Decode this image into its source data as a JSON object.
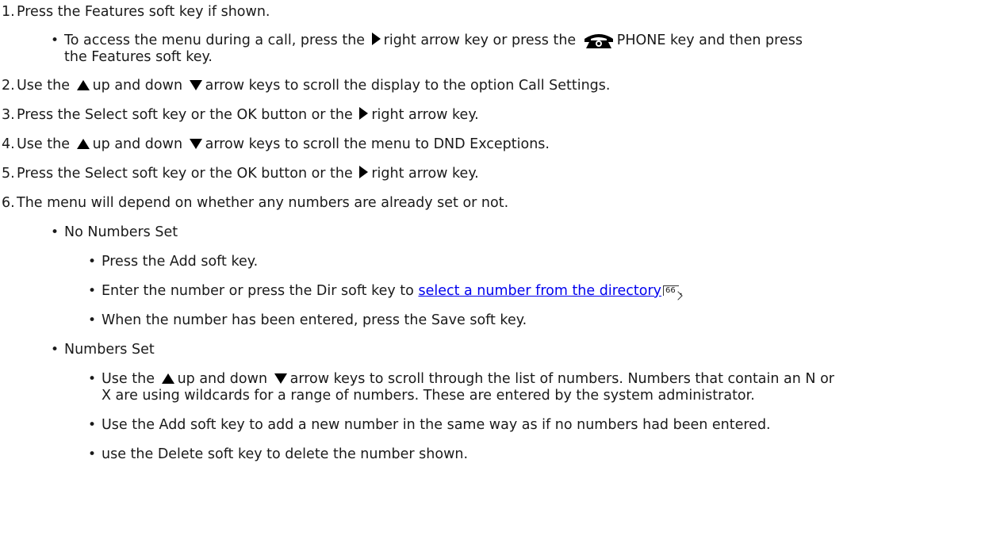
{
  "steps": [
    {
      "num": "1.",
      "text": "Press the Features soft key if shown."
    },
    {
      "num": "2.",
      "pre": "Use the",
      "mid": "up and down",
      "post": "arrow keys to scroll the display to the option Call Settings."
    },
    {
      "num": "3.",
      "pre": "Press the Select soft key or the OK button or the",
      "post": "right arrow key."
    },
    {
      "num": "4.",
      "pre": "Use the",
      "mid": "up and down",
      "post": "arrow keys to scroll the menu to DND Exceptions."
    },
    {
      "num": "5.",
      "pre": "Press the Select soft key or the OK button or the",
      "post": "right arrow key."
    },
    {
      "num": "6.",
      "text": "The menu will depend on whether any numbers are already set or not."
    }
  ],
  "sub1": {
    "pre": "To access the menu during a call, press the",
    "mid": "right arrow key or press the",
    "post": "PHONE key and then press",
    "line2": "the Features soft key."
  },
  "no_numbers": {
    "heading": "No Numbers Set",
    "add": "Press the Add soft key.",
    "dir_pre": "Enter the number or press the Dir soft key to",
    "dir_link": "select a number from the directory",
    "dir_ref": "66",
    "dir_post": ".",
    "save": "When the number has been entered, press the Save soft key."
  },
  "numbers_set": {
    "heading": "Numbers Set",
    "scroll_pre": "Use the",
    "scroll_mid": "up and down",
    "scroll_post": "arrow keys to scroll through the list of numbers. Numbers that contain an N or",
    "scroll_line2": "X are using wildcards for a range of numbers. These are entered by the system administrator.",
    "add": "Use the Add soft key to add a new number in the same way as if no numbers had been entered.",
    "delete": "use the Delete soft key to delete the number shown."
  },
  "icons": {
    "phone": "phone-icon",
    "right": "right-arrow-icon",
    "up": "up-arrow-icon",
    "down": "down-arrow-icon"
  }
}
